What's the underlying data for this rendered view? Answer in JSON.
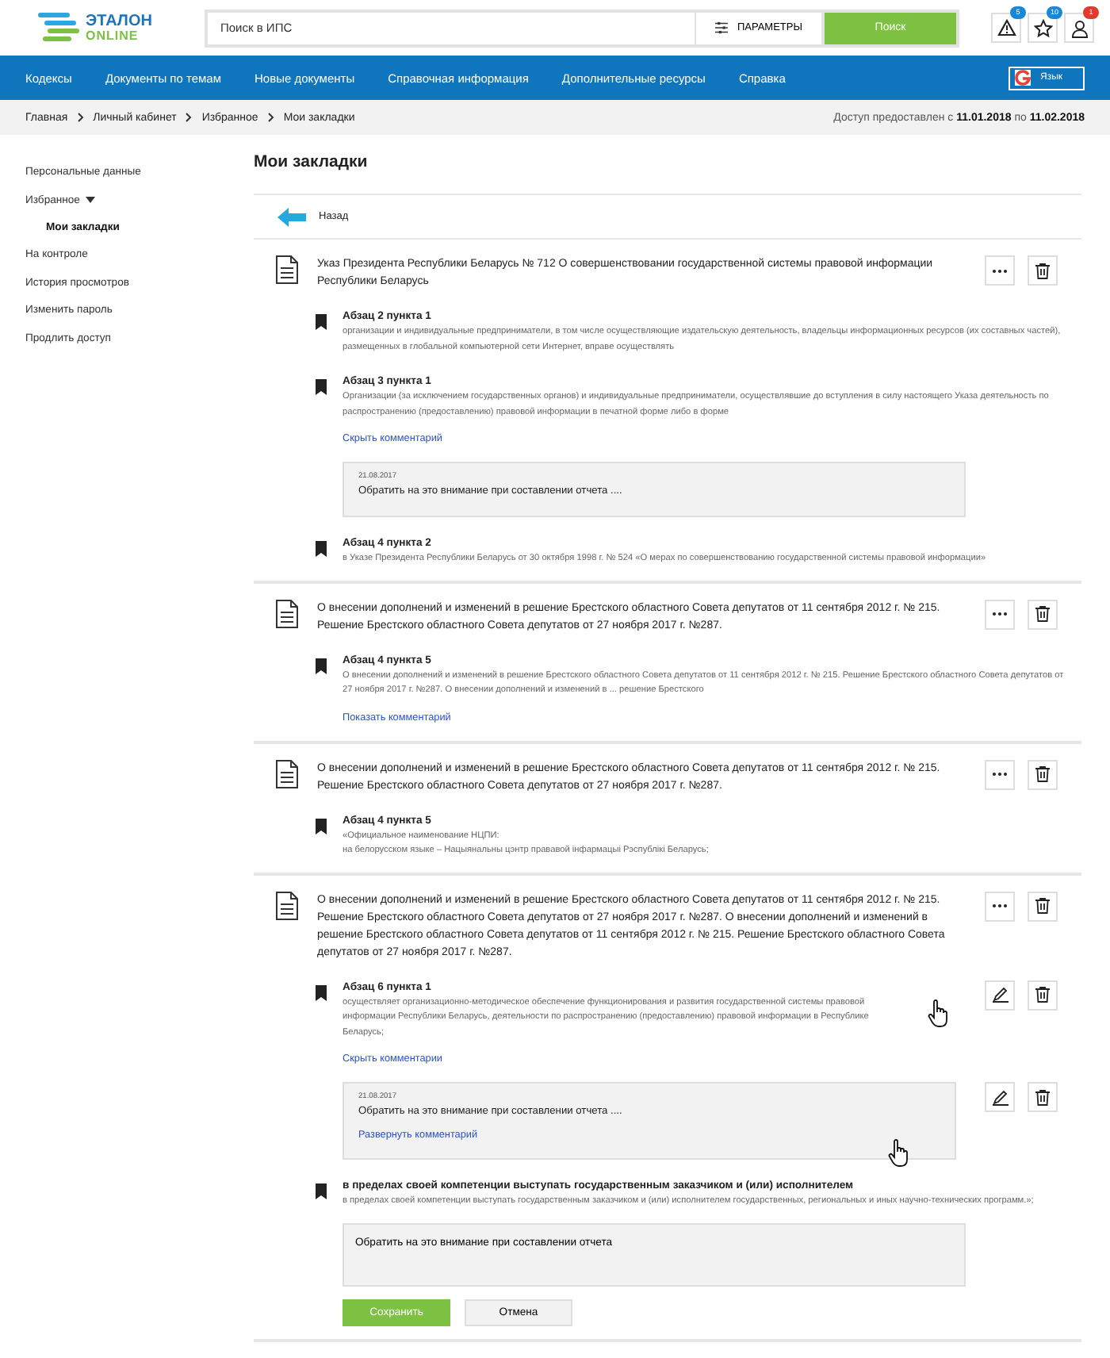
{
  "header": {
    "logo": {
      "line1": "ЭТАЛОН",
      "line2": "ONLINE"
    },
    "search": {
      "placeholder": "Поиск в ИПС"
    },
    "params_button": "ПАРАМЕТРЫ",
    "search_button": "Поиск",
    "icons": [
      {
        "kind": "warning",
        "badge": "5",
        "color": "#1a86d6"
      },
      {
        "kind": "star",
        "badge": "10",
        "color": "#1a86d6"
      },
      {
        "kind": "user",
        "badge": "1",
        "color": "#e0392d"
      }
    ]
  },
  "nav": {
    "items": [
      "Кодексы",
      "Документы по темам",
      "Новые документы",
      "Справочная информация",
      "Дополнительные ресурсы",
      "Справка"
    ],
    "language": "Язык"
  },
  "breadcrumb": [
    "Главная",
    "Личный кабинет",
    "Избранное",
    "Мои закладки"
  ],
  "access": "Доступ предоставлен с **11.01.2018** по **11.02.2018**",
  "sidebar": {
    "items": [
      {
        "label": "Персональные данные",
        "selected": false
      },
      {
        "label": "Избранное",
        "selected": false,
        "expanded": true,
        "children": [
          {
            "label": "Мои закладки",
            "selected": true
          }
        ]
      },
      {
        "label": "На контроле",
        "selected": false
      },
      {
        "label": "История просмотров",
        "selected": false
      },
      {
        "label": "Изменить пароль",
        "selected": false
      },
      {
        "label": "Продлить доступ",
        "selected": false
      }
    ]
  },
  "page_title": "Мои закладки",
  "back": "Назад",
  "documents": [
    {
      "title": "Указ Президента Республики Беларусь № 712 О совершенствовании государственной системы правовой информации Республики Беларусь",
      "bookmarks": [
        {
          "title": "Абзац 2 пункта 1",
          "text": "организации и индивидуальные предприниматели, в том числе осуществляющие издательскую деятельность, владельцы информационных ресурсов (их составных частей), размещенных в глобальной компьютерной сети Интернет, вправе осуществлять"
        },
        {
          "title": "Абзац 3 пункта 1",
          "text": "Организации (за исключением государственных органов) и индивидуальные предприниматели, осуществлявшие до вступления в силу настоящего Указа деятельность по распространению (предоставлению) правовой информации в печатной форме либо в форме",
          "toggle": "Скрыть комментарий",
          "comment": {
            "date": "21.08.2017",
            "text": "Обратить на это внимание при составлении отчета ...."
          }
        },
        {
          "title": "Абзац 4 пункта 2",
          "text": "в Указе Президента Республики Беларусь от 30 октября 1998 г. № 524 «О мерах по совершенствованию государственной системы правовой информации»"
        }
      ]
    },
    {
      "title": "О внесении дополнений и изменений в решение Брестского областного Совета депутатов от 11 сентября 2012 г. № 215. Решение Брестского областного Совета депутатов от 27 ноября 2017 г. №287.",
      "bookmarks": [
        {
          "title": "Абзац 4 пункта 5",
          "text": "О внесении дополнений и изменений в решение Брестского областного Совета депутатов от 11 сентября 2012 г. № 215. Решение Брестского областного Совета депутатов от 27 ноября 2017 г. №287. О внесении дополнений и изменений в ... решение Брестского",
          "toggle": "Показать комментарий"
        }
      ]
    },
    {
      "title": "О внесении дополнений и изменений в решение Брестского областного Совета депутатов от 11 сентября 2012 г. № 215. Решение Брестского областного Совета депутатов от 27 ноября 2017 г. №287.",
      "bookmarks": [
        {
          "title": "Абзац 4 пункта 5",
          "text": "«Официальное наименование НЦПИ:\nна белорусском языке – Нацыянальны цэнтр прававой інфармацыі Рэспублікі Беларусь;"
        }
      ]
    },
    {
      "title": "О внесении дополнений и изменений в решение Брестского областного Совета депутатов от 11 сентября 2012 г. № 215. Решение Брестского областного Совета депутатов от 27 ноября 2017 г. №287. О внесении дополнений и изменений в решение Брестского областного Совета депутатов от 11 сентября 2012 г. № 215. Решение Брестского областного Совета депутатов от 27 ноября 2017 г. №287.",
      "bookmarks": [
        {
          "title": "Абзац 6 пункта 1",
          "text": "осуществляет организационно-методическое обеспечение функционирования и развития государственной системы правовой информации Республики Беларусь, деятельности по распространению (предоставлению) правовой информации в Республике Беларусь;",
          "actions": true,
          "cursor": true,
          "toggle": "Скрыть комментарии",
          "comment": {
            "date": "21.08.2017",
            "text": "Обратить на это внимание при составлении отчета ....",
            "link": "Развернуть комментарий",
            "actions": true,
            "cursor": true
          }
        },
        {
          "title": "в пределах своей компетенции выступать государственным заказчиком и (или) исполнителем",
          "text": "в пределах своей компетенции выступать государственным заказчиком и (или) исполнителем государственных, региональных и иных научно-технических программ.»;",
          "editor": {
            "value": "Обратить на это внимание при составлении отчета",
            "save": "Сохранить",
            "cancel": "Отмена"
          }
        }
      ]
    }
  ]
}
